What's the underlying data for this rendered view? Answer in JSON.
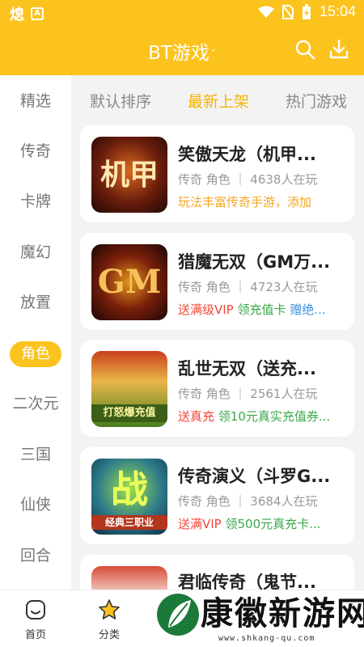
{
  "status_bar": {
    "time": "15:04",
    "app_icon_1": "熄",
    "app_icon_2": "A"
  },
  "header": {
    "title": "BT游戏",
    "caret": "˅"
  },
  "sidebar": {
    "items": [
      {
        "label": "精选"
      },
      {
        "label": "传奇"
      },
      {
        "label": "卡牌"
      },
      {
        "label": "魔幻"
      },
      {
        "label": "放置"
      },
      {
        "label": "角色",
        "active": true
      },
      {
        "label": "二次元"
      },
      {
        "label": "三国"
      },
      {
        "label": "仙侠"
      },
      {
        "label": "回合"
      }
    ]
  },
  "sort_tabs": [
    {
      "label": "默认排序"
    },
    {
      "label": "最新上架",
      "active": true
    },
    {
      "label": "热门游戏"
    }
  ],
  "games": [
    {
      "title": "笑傲天龙（机甲...",
      "meta": "传奇 角色 ｜ 4638人在玩",
      "tags": [
        {
          "text": "玩法丰富传奇手游，添加",
          "color": "orange"
        }
      ],
      "thumb_text": "机甲"
    },
    {
      "title": "猎魔无双（GM万...",
      "meta": "传奇 角色 ｜ 4723人在玩",
      "tags": [
        {
          "text": "送满级VIP",
          "color": "red"
        },
        {
          "text": "领充值卡",
          "color": "green"
        },
        {
          "text": "赠绝...",
          "color": "blue"
        }
      ],
      "thumb_text": "GM"
    },
    {
      "title": "乱世无双（送充...",
      "meta": "传奇 角色 ｜ 2561人在玩",
      "tags": [
        {
          "text": "送真充",
          "color": "red"
        },
        {
          "text": "领10元真实充值券...",
          "color": "green"
        }
      ],
      "thumb_text": "打怒爆充值"
    },
    {
      "title": "传奇演义（斗罗G...",
      "meta": "传奇 角色 ｜ 3684人在玩",
      "tags": [
        {
          "text": "送满VIP",
          "color": "red"
        },
        {
          "text": "领500元真充卡...",
          "color": "green"
        }
      ],
      "thumb_text": "战",
      "thumb_sub": "经典三职业"
    },
    {
      "title": "君临传奇（鬼节...",
      "meta": "",
      "tags": [],
      "thumb_text": ""
    }
  ],
  "tabbar": {
    "items": [
      {
        "label": "首页"
      },
      {
        "label": "分类",
        "active": true
      }
    ]
  },
  "watermark": {
    "name": "康徽新游网",
    "url": "www.shkang-qu.com"
  },
  "colors": {
    "brand": "#fcc31e",
    "active_sort": "#f5b400"
  }
}
